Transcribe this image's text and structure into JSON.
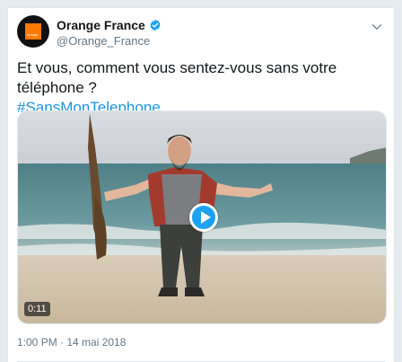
{
  "tweet": {
    "author": {
      "display_name": "Orange France",
      "handle": "@Orange_France",
      "avatar_text": "orange"
    },
    "text": "Et vous, comment vous sentez-vous sans votre téléphone ?",
    "hashtag": "#SansMonTelephone",
    "media": {
      "type": "video",
      "duration": "0:11"
    },
    "timestamp": "1:00 PM · 14 mai 2018"
  },
  "colors": {
    "brand_orange": "#ff7900",
    "link_blue": "#1b95e0",
    "play_blue": "#1da1f2",
    "secondary_text": "#657786"
  },
  "icons": [
    "verified-badge-icon",
    "chevron-down-icon",
    "play-icon"
  ]
}
